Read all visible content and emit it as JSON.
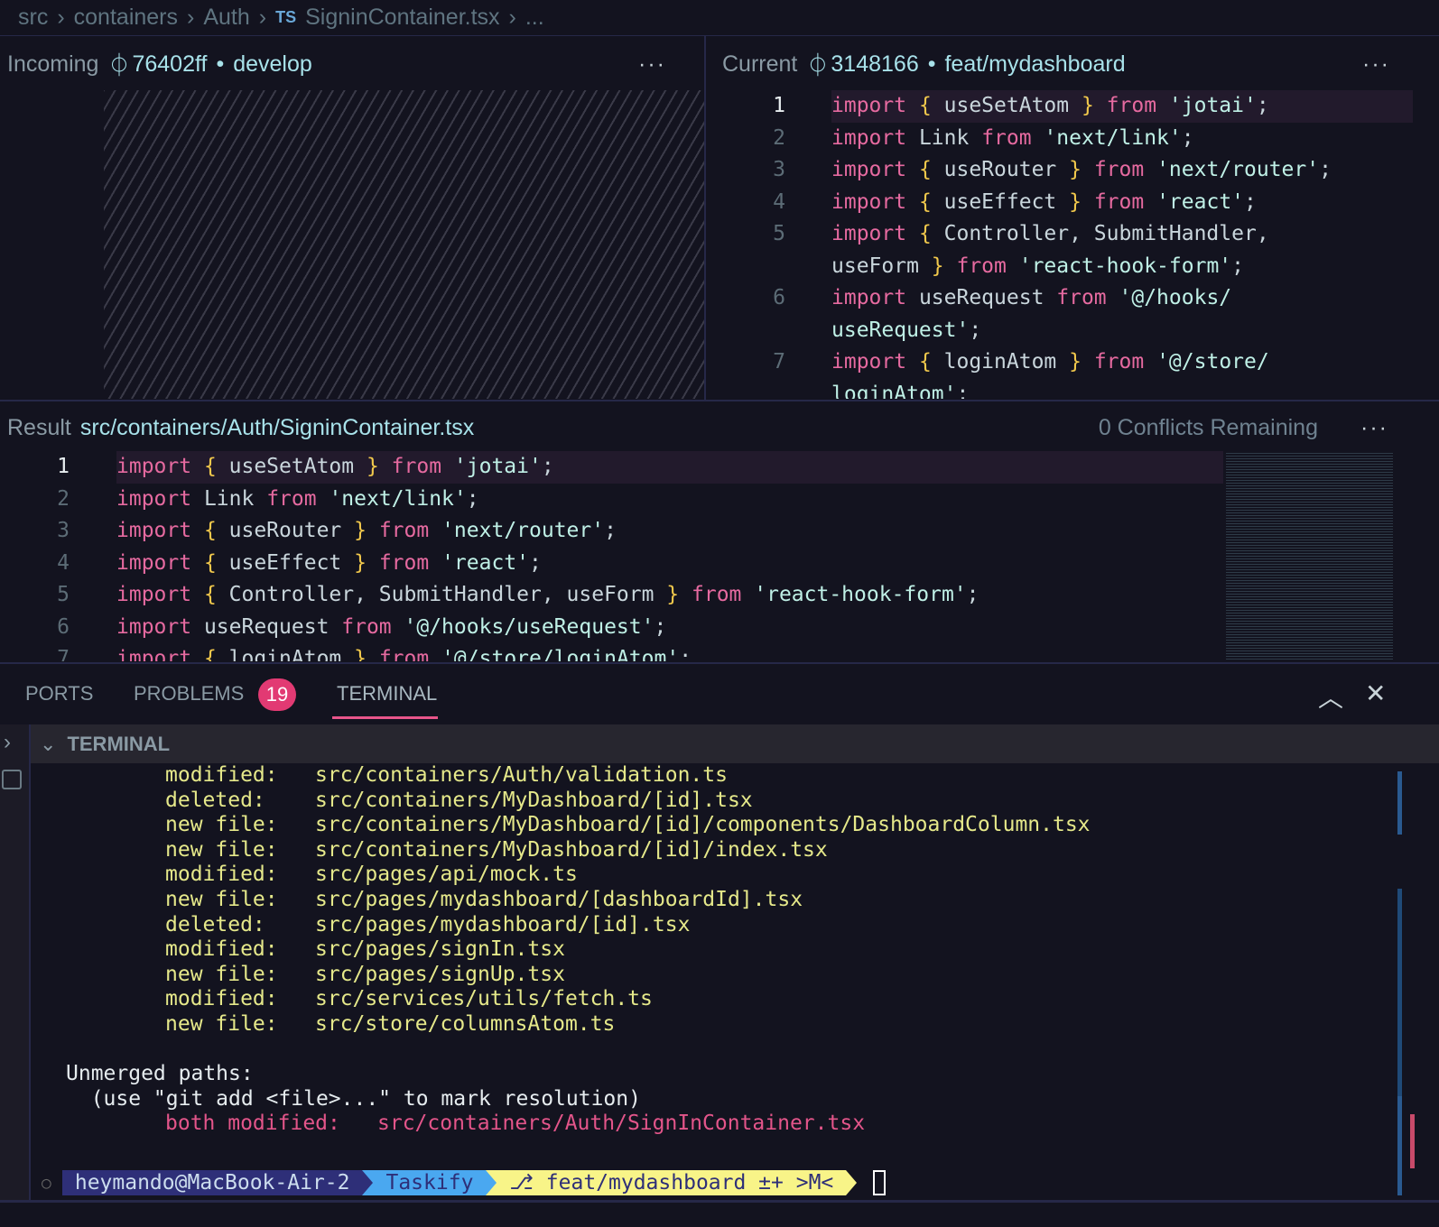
{
  "breadcrumb": {
    "items": [
      "src",
      "containers",
      "Auth",
      "SigninContainer.tsx",
      "..."
    ],
    "file_icon": "TS"
  },
  "incoming": {
    "label": "Incoming",
    "commit": "76402ff",
    "branch": "develop",
    "more": "···"
  },
  "current": {
    "label": "Current",
    "commit": "3148166",
    "branch": "feat/mydashboard",
    "more": "···",
    "lines": [
      {
        "n": "1",
        "parts": [
          [
            "k",
            "import"
          ],
          [
            "",
            ""
          ],
          [
            "b",
            " {"
          ],
          [
            "",
            " useSetAtom "
          ],
          [
            "b",
            "}"
          ],
          [
            "k",
            " from "
          ],
          [
            "s",
            "'jotai'"
          ],
          [
            "",
            ";"
          ]
        ]
      },
      {
        "n": "2",
        "parts": [
          [
            "k",
            "import"
          ],
          [
            "",
            " Link "
          ],
          [
            "k",
            "from "
          ],
          [
            "s",
            "'next/link'"
          ],
          [
            "",
            ";"
          ]
        ]
      },
      {
        "n": "3",
        "parts": [
          [
            "k",
            "import"
          ],
          [
            "b",
            " {"
          ],
          [
            "",
            " useRouter "
          ],
          [
            "b",
            "}"
          ],
          [
            "k",
            " from "
          ],
          [
            "s",
            "'next/router'"
          ],
          [
            "",
            ";"
          ]
        ]
      },
      {
        "n": "4",
        "parts": [
          [
            "k",
            "import"
          ],
          [
            "b",
            " {"
          ],
          [
            "",
            " useEffect "
          ],
          [
            "b",
            "}"
          ],
          [
            "k",
            " from "
          ],
          [
            "s",
            "'react'"
          ],
          [
            "",
            ";"
          ]
        ]
      },
      {
        "n": "5",
        "parts": [
          [
            "k",
            "import"
          ],
          [
            "b",
            " {"
          ],
          [
            "",
            " Controller, SubmitHandler,"
          ]
        ]
      },
      {
        "n": "",
        "parts": [
          [
            "",
            "useForm "
          ],
          [
            "b",
            "}"
          ],
          [
            "k",
            " from "
          ],
          [
            "s",
            "'react-hook-form'"
          ],
          [
            "",
            ";"
          ]
        ]
      },
      {
        "n": "6",
        "parts": [
          [
            "k",
            "import"
          ],
          [
            "",
            " useRequest "
          ],
          [
            "k",
            "from "
          ],
          [
            "s",
            "'@/hooks/"
          ]
        ]
      },
      {
        "n": "",
        "parts": [
          [
            "s",
            "useRequest'"
          ],
          [
            "",
            ";"
          ]
        ]
      },
      {
        "n": "7",
        "parts": [
          [
            "k",
            "import"
          ],
          [
            "b",
            " {"
          ],
          [
            "",
            " loginAtom "
          ],
          [
            "b",
            "}"
          ],
          [
            "k",
            " from "
          ],
          [
            "s",
            "'@/store/"
          ]
        ]
      },
      {
        "n": "",
        "parts": [
          [
            "s",
            "loginAtom'"
          ],
          [
            "",
            ";"
          ]
        ]
      }
    ]
  },
  "result": {
    "label": "Result",
    "path": "src/containers/Auth/SigninContainer.tsx",
    "conflicts": "0 Conflicts Remaining",
    "more": "···",
    "lines": [
      {
        "n": "1",
        "parts": [
          [
            "k",
            "import"
          ],
          [
            "b",
            " {"
          ],
          [
            "",
            " useSetAtom "
          ],
          [
            "b",
            "}"
          ],
          [
            "k",
            " from "
          ],
          [
            "s",
            "'jotai'"
          ],
          [
            "",
            ";"
          ]
        ]
      },
      {
        "n": "2",
        "parts": [
          [
            "k",
            "import"
          ],
          [
            "",
            " Link "
          ],
          [
            "k",
            "from "
          ],
          [
            "s",
            "'next/link'"
          ],
          [
            "",
            ";"
          ]
        ]
      },
      {
        "n": "3",
        "parts": [
          [
            "k",
            "import"
          ],
          [
            "b",
            " {"
          ],
          [
            "",
            " useRouter "
          ],
          [
            "b",
            "}"
          ],
          [
            "k",
            " from "
          ],
          [
            "s",
            "'next/router'"
          ],
          [
            "",
            ";"
          ]
        ]
      },
      {
        "n": "4",
        "parts": [
          [
            "k",
            "import"
          ],
          [
            "b",
            " {"
          ],
          [
            "",
            " useEffect "
          ],
          [
            "b",
            "}"
          ],
          [
            "k",
            " from "
          ],
          [
            "s",
            "'react'"
          ],
          [
            "",
            ";"
          ]
        ]
      },
      {
        "n": "5",
        "parts": [
          [
            "k",
            "import"
          ],
          [
            "b",
            " {"
          ],
          [
            "",
            " Controller, SubmitHandler, useForm "
          ],
          [
            "b",
            "}"
          ],
          [
            "k",
            " from "
          ],
          [
            "s",
            "'react-hook-form'"
          ],
          [
            "",
            ";"
          ]
        ]
      },
      {
        "n": "6",
        "parts": [
          [
            "k",
            "import"
          ],
          [
            "",
            " useRequest "
          ],
          [
            "k",
            "from "
          ],
          [
            "s",
            "'@/hooks/useRequest'"
          ],
          [
            "",
            ";"
          ]
        ]
      },
      {
        "n": "7",
        "parts": [
          [
            "k",
            "import"
          ],
          [
            "b",
            " {"
          ],
          [
            "",
            " loginAtom "
          ],
          [
            "b",
            "}"
          ],
          [
            "k",
            " from "
          ],
          [
            "s",
            "'@/store/loginAtom'"
          ],
          [
            "",
            ";"
          ]
        ]
      }
    ]
  },
  "panel": {
    "tabs": [
      "PORTS",
      "PROBLEMS",
      "TERMINAL"
    ],
    "problems_count": "19",
    "section": "TERMINAL"
  },
  "terminal": {
    "changes": [
      [
        "modified:",
        "src/containers/Auth/validation.ts"
      ],
      [
        "deleted:",
        "src/containers/MyDashboard/[id].tsx"
      ],
      [
        "new file:",
        "src/containers/MyDashboard/[id]/components/DashboardColumn.tsx"
      ],
      [
        "new file:",
        "src/containers/MyDashboard/[id]/index.tsx"
      ],
      [
        "modified:",
        "src/pages/api/mock.ts"
      ],
      [
        "new file:",
        "src/pages/mydashboard/[dashboardId].tsx"
      ],
      [
        "deleted:",
        "src/pages/mydashboard/[id].tsx"
      ],
      [
        "modified:",
        "src/pages/signIn.tsx"
      ],
      [
        "new file:",
        "src/pages/signUp.tsx"
      ],
      [
        "modified:",
        "src/services/utils/fetch.ts"
      ],
      [
        "new file:",
        "src/store/columnsAtom.ts"
      ]
    ],
    "unmerged_header": "Unmerged paths:",
    "unmerged_hint": "  (use \"git add <file>...\" to mark resolution)",
    "unmerged": {
      "status": "both modified:",
      "path": "src/containers/Auth/SignInContainer.tsx"
    },
    "prompt": {
      "user": "heymando@MacBook-Air-2",
      "dir": "Taskify",
      "branch": "⎇ feat/mydashboard ±+ >M<"
    }
  },
  "colors": {
    "bg": "#13131f",
    "keyword": "#e66aa0",
    "brace": "#f2c94c",
    "string": "#bff0e6",
    "badge": "#e23a73"
  }
}
